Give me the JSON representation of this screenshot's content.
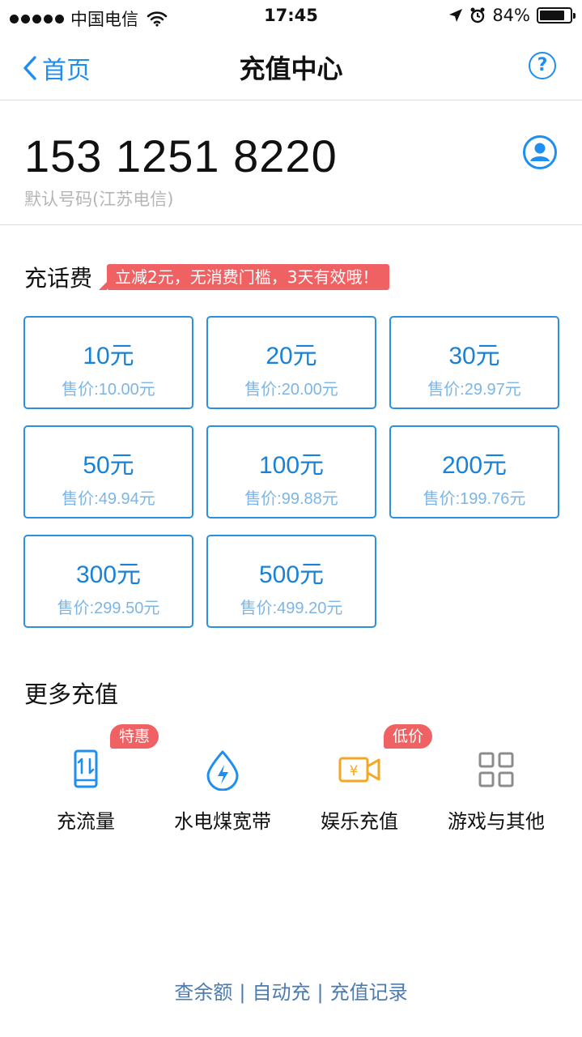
{
  "status_bar": {
    "carrier": "中国电信",
    "time": "17:45",
    "battery": "84%",
    "battery_level": 0.84
  },
  "nav": {
    "back_label": "首页",
    "title": "充值中心",
    "help_label": "?"
  },
  "phone": {
    "number": "153 1251 8220",
    "subtitle": "默认号码(江苏电信)"
  },
  "recharge": {
    "title": "充话费",
    "promo": "立减2元，无消费门槛，3天有效哦！",
    "options": [
      {
        "amount": "10元",
        "price": "售价:10.00元"
      },
      {
        "amount": "20元",
        "price": "售价:20.00元"
      },
      {
        "amount": "30元",
        "price": "售价:29.97元"
      },
      {
        "amount": "50元",
        "price": "售价:49.94元"
      },
      {
        "amount": "100元",
        "price": "售价:99.88元"
      },
      {
        "amount": "200元",
        "price": "售价:199.76元"
      },
      {
        "amount": "300元",
        "price": "售价:299.50元"
      },
      {
        "amount": "500元",
        "price": "售价:499.20元"
      }
    ]
  },
  "more": {
    "title": "更多充值",
    "items": [
      {
        "label": "充流量",
        "icon": "phone-data-icon",
        "badge": "特惠"
      },
      {
        "label": "水电煤宽带",
        "icon": "water-drop-bolt-icon",
        "badge": ""
      },
      {
        "label": "娱乐充值",
        "icon": "video-yuan-icon",
        "badge": "低价"
      },
      {
        "label": "游戏与其他",
        "icon": "grid-icon",
        "badge": ""
      }
    ]
  },
  "footer": {
    "links": [
      "查余额",
      "自动充",
      "充值记录"
    ],
    "separator": "|"
  },
  "colors": {
    "accent": "#1e8ef0",
    "tile_border": "#2a90e0",
    "badge": "#ef6163",
    "entertainment_icon": "#f5a623",
    "grid_icon": "#8c8c8c"
  }
}
